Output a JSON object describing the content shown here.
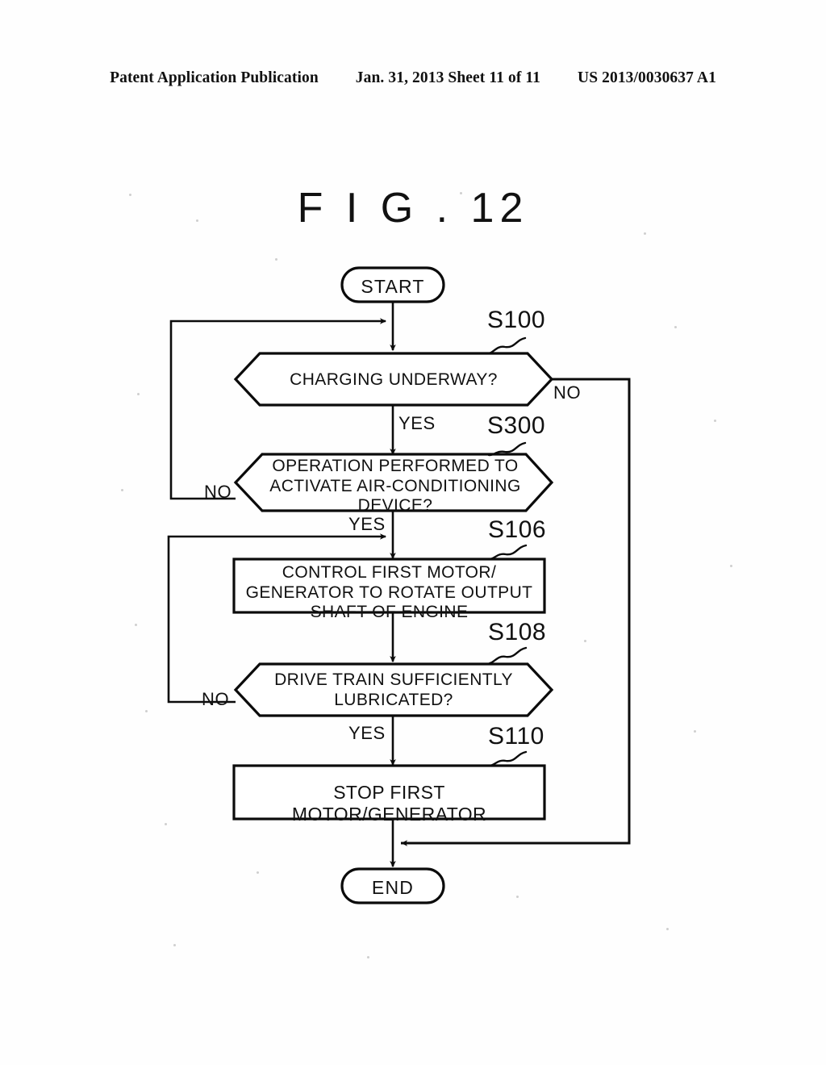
{
  "header": {
    "publication": "Patent Application Publication",
    "date_sheet": "Jan. 31, 2013  Sheet 11 of 11",
    "doc_number": "US 2013/0030637 A1"
  },
  "figure": {
    "title": "F I G . 12"
  },
  "flowchart": {
    "nodes": {
      "start": {
        "label": "START",
        "type": "terminal"
      },
      "s100": {
        "label": "CHARGING UNDERWAY?",
        "type": "decision",
        "step": "S100"
      },
      "s300": {
        "label": "OPERATION PERFORMED TO\nACTIVATE AIR-CONDITIONING\nDEVICE?",
        "type": "decision",
        "step": "S300"
      },
      "s106": {
        "label": "CONTROL FIRST MOTOR/\nGENERATOR TO ROTATE OUTPUT\nSHAFT OF ENGINE",
        "type": "process",
        "step": "S106"
      },
      "s108": {
        "label": "DRIVE TRAIN SUFFICIENTLY\nLUBRICATED?",
        "type": "decision",
        "step": "S108"
      },
      "s110": {
        "label": "STOP FIRST MOTOR/GENERATOR",
        "type": "process",
        "step": "S110"
      },
      "end": {
        "label": "END",
        "type": "terminal"
      }
    },
    "edges": {
      "s100_yes": "YES",
      "s100_no": "NO",
      "s300_yes": "YES",
      "s300_no": "NO",
      "s108_yes": "YES",
      "s108_no": "NO"
    }
  },
  "colors": {
    "ink": "#0b0b0b",
    "paper": "#ffffff"
  }
}
